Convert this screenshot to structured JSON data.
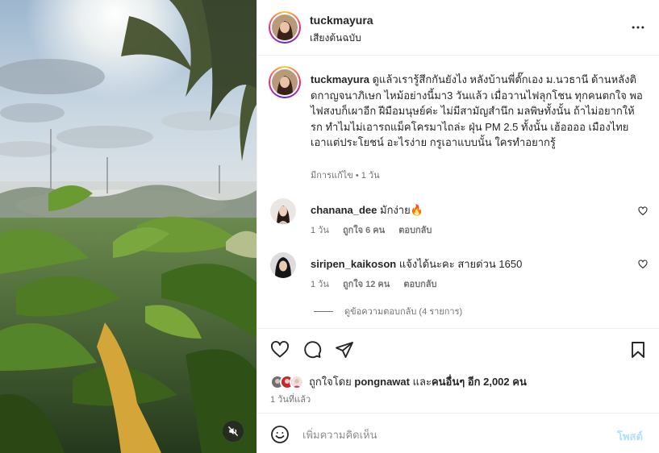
{
  "post": {
    "username": "tuckmayura",
    "audio_label": "เสียงต้นฉบับ",
    "caption": {
      "username": "tuckmayura",
      "text": "ดูแล้วเรารู้สึกกันยังไง หลังบ้านพี่ตั๊กเอง ม.นวธานี ด้านหลังติดกาญจนาภิเษก ไหม้อย่างนี้มา3 วันแล้ว เมื่อวานไฟลุกโชน ทุกคนตกใจ พอไฟสงบก็เผาอีก ฝีมือมนุษย์ค่ะ ไม่มีสามัญสำนึก มลพิษทั้งนั้น ถ้าไม่อยากให้รก ทำไมไม่เอารถแม็คโครมาไถล่ะ ฝุ่น PM 2.5 ทั้งนั้น เฮ้ออออ เมืองไทย เอาแต่ประโยชน์ อะไรง่าย กรูเอาแบบนั้น ใครทำอยากรู้",
      "meta": "มีการแก้ไข • 1 วัน"
    }
  },
  "comments": [
    {
      "username": "chanana_dee",
      "text": "มักง่าย🔥",
      "time": "1 วัน",
      "likes": "ถูกใจ 6 คน",
      "reply_label": "ตอบกลับ"
    },
    {
      "username": "siripen_kaikoson",
      "text": "แจ้งได้นะคะ สายด่วน 1650",
      "time": "1 วัน",
      "likes": "ถูกใจ 12 คน",
      "reply_label": "ตอบกลับ"
    }
  ],
  "view_replies": "ดูข้อความตอบกลับ (4 รายการ)",
  "likes_summary": {
    "prefix": "ถูกใจโดย ",
    "user": "pongnawat",
    "middle": " และ",
    "others": "คนอื่นๆ อีก 2,002 คน"
  },
  "time_ago": "1 วันที่แล้ว",
  "add_comment": {
    "placeholder": "เพิ่มความคิดเห็น",
    "post_label": "โพสต์"
  },
  "icons": {
    "more": "more-horizontal-icon",
    "like": "heart-icon",
    "comment": "comment-icon",
    "share": "send-icon",
    "save": "bookmark-icon",
    "emoji": "emoji-icon",
    "mute": "speaker-muted-icon"
  },
  "colors": {
    "text": "#262626",
    "secondary": "#737373",
    "post_disabled": "#b2dffc",
    "border": "#efefef"
  }
}
